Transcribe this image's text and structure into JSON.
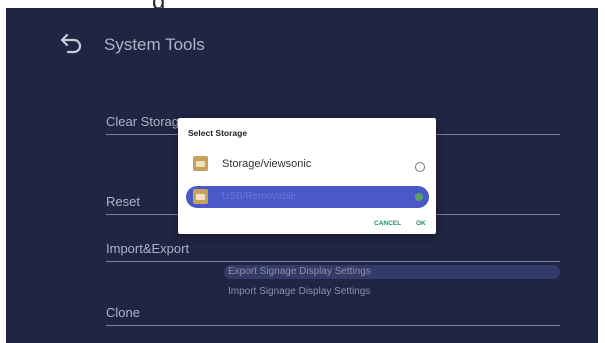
{
  "top_fragment": "g",
  "header": {
    "title": "System Tools",
    "back_icon": "back-arrow-icon"
  },
  "menu": {
    "clear_storage": "Clear Storag",
    "reset": "Reset",
    "import_export": "Import&Export",
    "clone": "Clone"
  },
  "submenu": {
    "export": "Export Signage Display Settings",
    "import": "Import Signage Display Settings"
  },
  "dialog": {
    "title": "Select Storage",
    "options": [
      {
        "label": "Storage/viewsonic",
        "selected": false,
        "icon": "folder-icon"
      },
      {
        "label": "USB/Removable",
        "selected": true,
        "icon": "folder-icon"
      }
    ],
    "cancel": "CANCEL",
    "ok": "OK"
  },
  "colors": {
    "background": "#1f2542",
    "highlight": "#343b68",
    "selection": "#4a58c8",
    "button_text": "#1f8f6a"
  }
}
